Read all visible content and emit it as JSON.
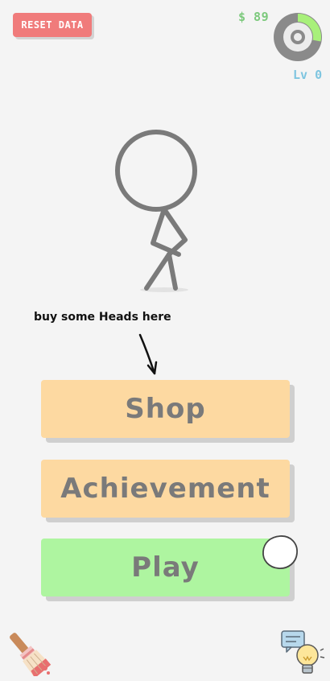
{
  "header": {
    "reset_label": "RESET DATA",
    "money": "$ 89",
    "level": "Lv 0",
    "xp_progress": 0.28
  },
  "hint": {
    "text": "buy some Heads here"
  },
  "menu": {
    "shop_label": "Shop",
    "achievement_label": "Achievement",
    "play_label": "Play"
  },
  "colors": {
    "reset": "#f07b7b",
    "money": "#7cc97c",
    "level": "#7ec5e0",
    "xp_fill": "#a8f07a",
    "button_orange": "#fdd9a1",
    "button_green": "#aef5a0",
    "button_text": "#7a7a7a"
  },
  "icons": {
    "bottom_left": "paint-brush-icon",
    "bottom_right": "lightbulb-chat-icon"
  }
}
